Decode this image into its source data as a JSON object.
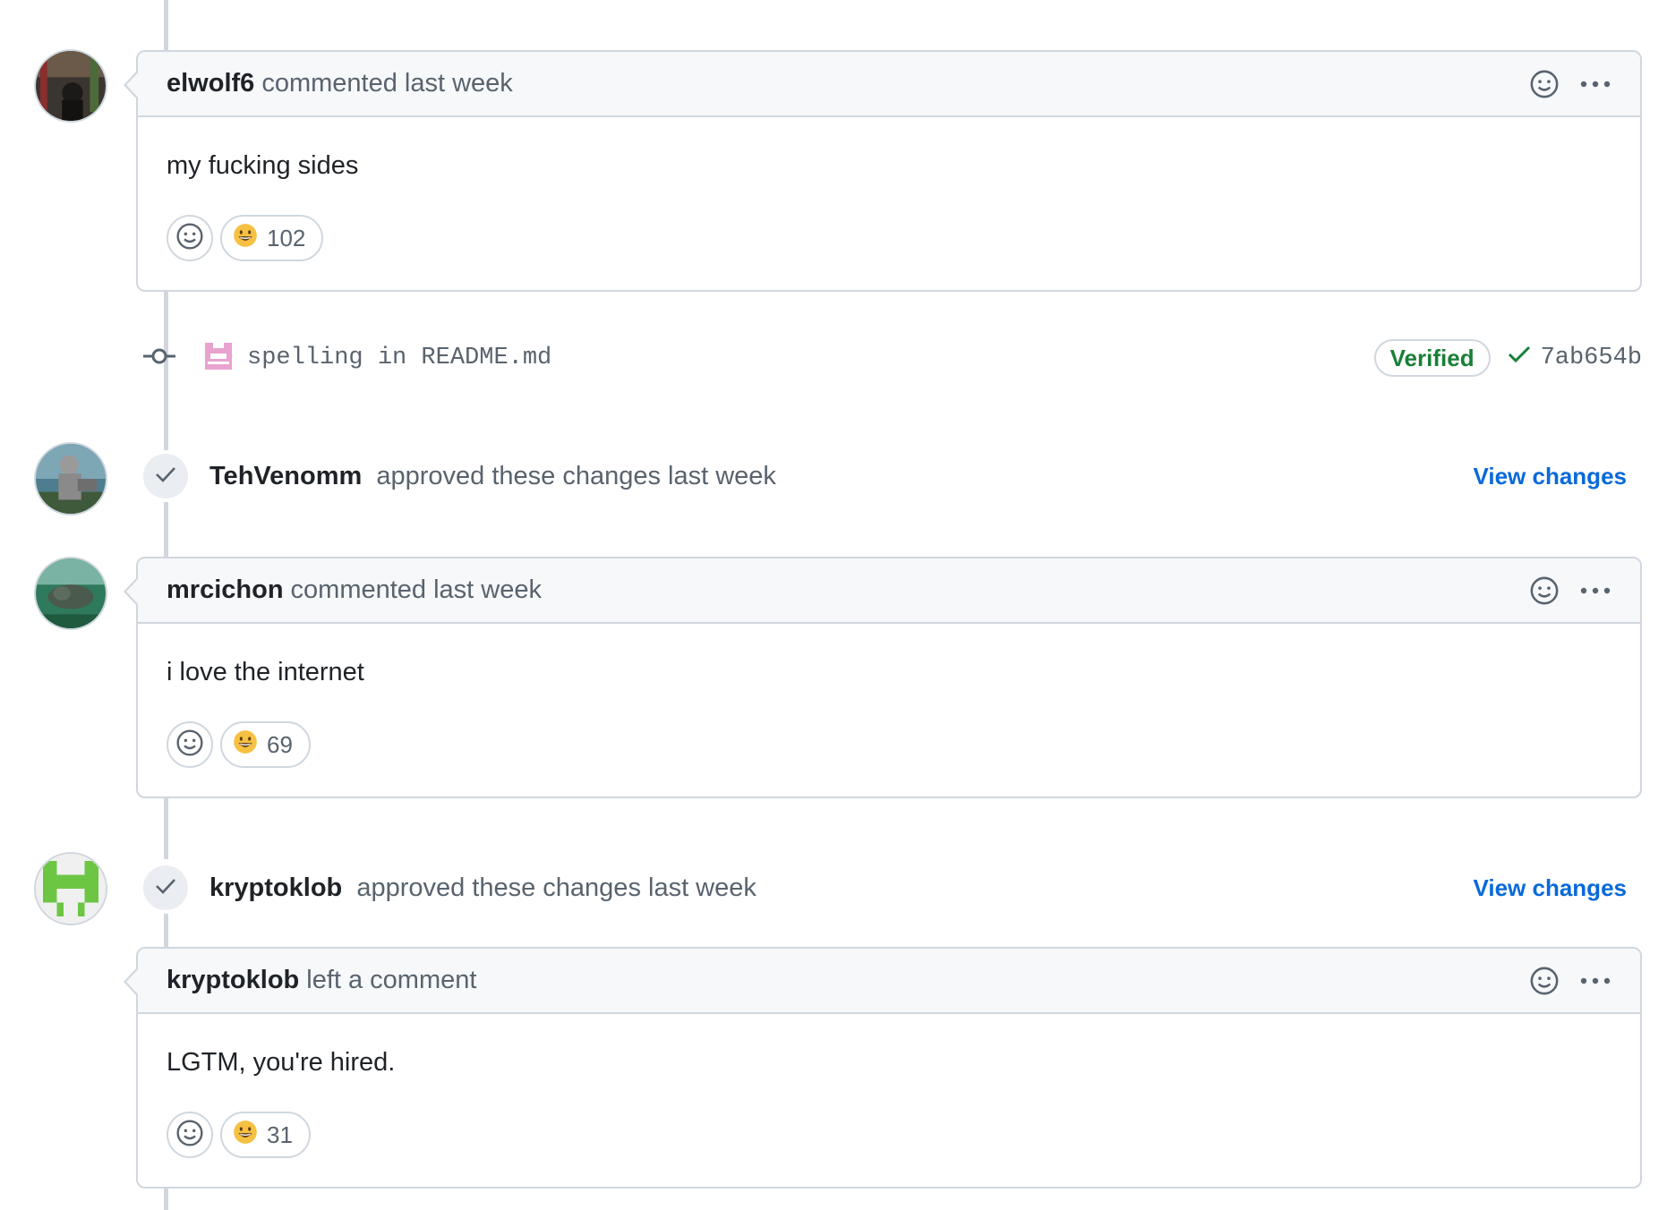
{
  "comments": [
    {
      "author": "elwolf6",
      "meta": "commented last week",
      "body": "my fucking sides",
      "reaction_emoji": "grinning-face",
      "reaction_count": "102"
    },
    {
      "author": "mrcichon",
      "meta": "commented last week",
      "body": "i love the internet",
      "reaction_emoji": "grinning-face",
      "reaction_count": "69"
    },
    {
      "author": "kryptoklob",
      "meta": "left a comment",
      "body": "LGTM, you're hired.",
      "reaction_emoji": "grinning-face",
      "reaction_count": "31"
    }
  ],
  "commit": {
    "message": "spelling in README.md",
    "verified_label": "Verified",
    "sha": "7ab654b"
  },
  "reviews": [
    {
      "author": "TehVenomm",
      "meta": "approved these changes last week",
      "link": "View changes"
    },
    {
      "author": "kryptoklob",
      "meta": "approved these changes last week",
      "link": "View changes"
    }
  ],
  "colors": {
    "link": "#0969da",
    "verified": "#1a7f37",
    "border": "#d0d7de",
    "header_bg": "#f6f8fa"
  }
}
